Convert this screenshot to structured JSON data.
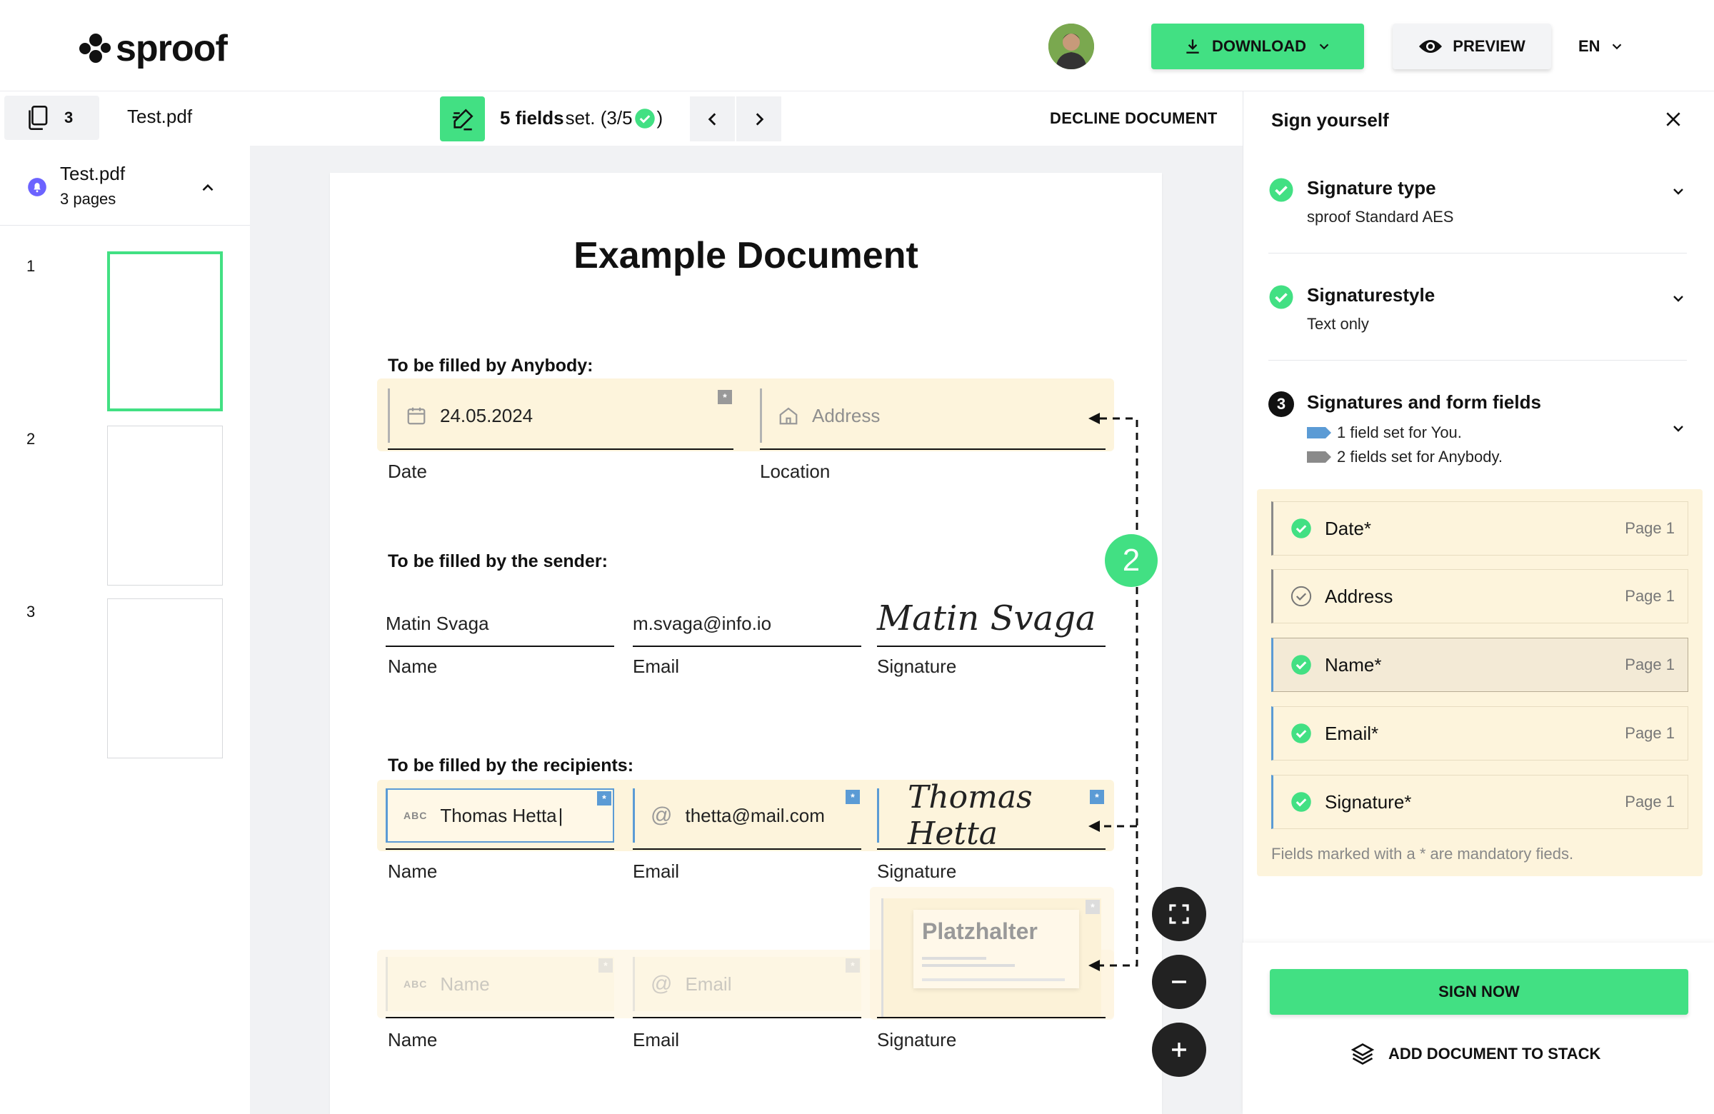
{
  "header": {
    "brand": "sproof",
    "download_label": "DOWNLOAD",
    "preview_label": "PREVIEW",
    "language": "EN"
  },
  "toolbar": {
    "doc_count": "3",
    "doc_name": "Test.pdf",
    "fields_bold": "5 fields",
    "fields_rest": " set. (3/5",
    "fields_close": ")",
    "decline_label": "DECLINE DOCUMENT"
  },
  "sidebar": {
    "file_name": "Test.pdf",
    "file_pages": "3 pages",
    "pages": [
      "1",
      "2",
      "3"
    ]
  },
  "document": {
    "title": "Example Document",
    "section_anybody": "To be filled by Anybody:",
    "date_value": "24.05.2024",
    "address_placeholder": "Address",
    "date_label": "Date",
    "location_label": "Location",
    "section_sender": "To be filled by the sender:",
    "sender_name": "Matin Svaga",
    "sender_email": "m.svaga@info.io",
    "sender_signature": "Matin Svaga",
    "name_label": "Name",
    "email_label": "Email",
    "signature_label": "Signature",
    "section_recipients": "To be filled by the recipients:",
    "recipient_name": "Thomas Hetta",
    "recipient_email": "thetta@mail.com",
    "recipient_signature": "Thomas Hetta",
    "name_placeholder": "Name",
    "email_placeholder": "Email",
    "placeholder_title": "Platzhalter",
    "step_badge": "2",
    "abc": "ABC"
  },
  "panel": {
    "title": "Sign yourself",
    "step1_title": "Signature type",
    "step1_value": "sproof Standard AES",
    "step2_title": "Signaturestyle",
    "step2_value": "Text only",
    "step3_number": "3",
    "step3_title": "Signatures and form fields",
    "step3_you": "1 field set for You.",
    "step3_anybody": "2 fields set for Anybody.",
    "fields": [
      {
        "label": "Date*",
        "page": "Page 1"
      },
      {
        "label": "Address",
        "page": "Page 1"
      },
      {
        "label": "Name*",
        "page": "Page 1"
      },
      {
        "label": "Email*",
        "page": "Page 1"
      },
      {
        "label": "Signature*",
        "page": "Page 1"
      }
    ],
    "hint": "Fields marked with a * are mandatory fieds.",
    "sign_label": "SIGN NOW",
    "stack_label": "ADD DOCUMENT TO STACK"
  },
  "colors": {
    "accent": "#42e083",
    "field_bg": "#fdf4dc",
    "recipient_blue": "#5b9bd5",
    "anybody_gray": "#8a8a8a"
  }
}
